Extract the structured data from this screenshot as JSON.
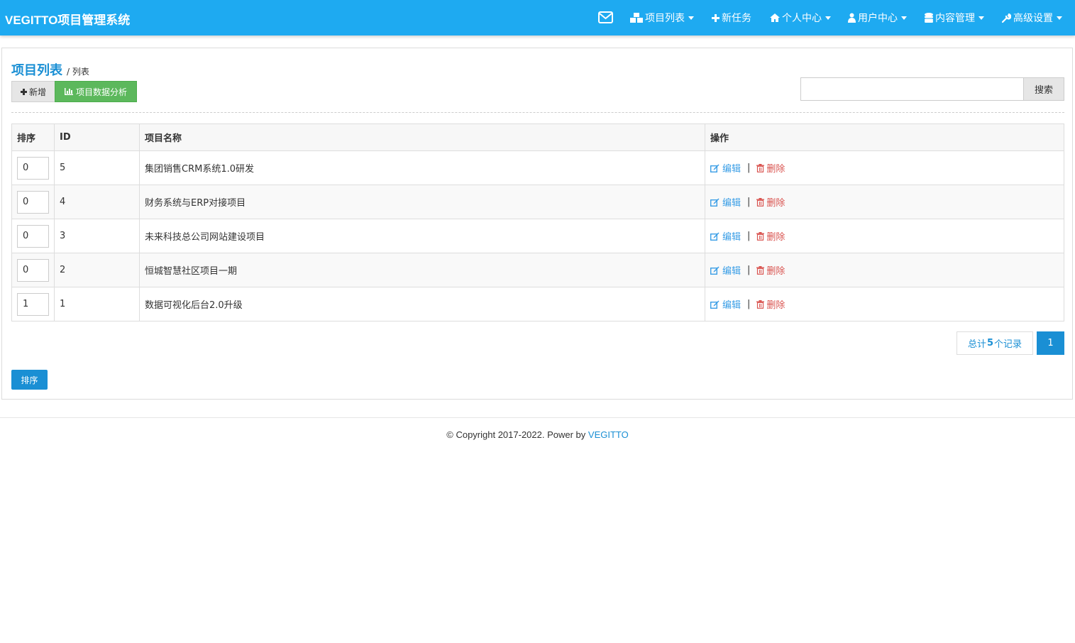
{
  "app": {
    "title": "VEGITTO项目管理系统"
  },
  "nav": {
    "items": [
      {
        "label": "项目列表",
        "icon": "cubes-icon",
        "dropdown": true
      },
      {
        "label": "新任务",
        "icon": "plus-icon",
        "dropdown": false
      },
      {
        "label": "个人中心",
        "icon": "home-icon",
        "dropdown": true
      },
      {
        "label": "用户中心",
        "icon": "user-icon",
        "dropdown": true
      },
      {
        "label": "内容管理",
        "icon": "database-icon",
        "dropdown": true
      },
      {
        "label": "高级设置",
        "icon": "wrench-icon",
        "dropdown": true
      }
    ]
  },
  "page": {
    "title": "项目列表",
    "subtitle": "/ 列表"
  },
  "toolbar": {
    "add_label": "新增",
    "analysis_label": "项目数据分析"
  },
  "search": {
    "placeholder": "",
    "button_label": "搜索"
  },
  "table": {
    "headers": [
      "排序",
      "ID",
      "项目名称",
      "操作"
    ],
    "rows": [
      {
        "sort": "0",
        "id": "5",
        "name": "集团销售CRM系统1.0研发"
      },
      {
        "sort": "0",
        "id": "4",
        "name": "财务系统与ERP对接项目"
      },
      {
        "sort": "0",
        "id": "3",
        "name": "未来科技总公司网站建设项目"
      },
      {
        "sort": "0",
        "id": "2",
        "name": "恒城智慧社区项目一期"
      },
      {
        "sort": "1",
        "id": "1",
        "name": "数据可视化后台2.0升级"
      }
    ],
    "edit_label": "编辑",
    "delete_label": "删除",
    "separator": "|"
  },
  "pagination": {
    "total_prefix": "总计",
    "total_count": "5",
    "total_suffix": "个记录",
    "current_page": "1"
  },
  "sort_button_label": "排序",
  "footer": {
    "copyright": "© Copyright 2017-2022. Power by ",
    "brand": "VEGITTO"
  },
  "colors": {
    "navbar": "#1eaaf1",
    "primary": "#1a8fd4",
    "success": "#5cb85c",
    "danger": "#d9534f"
  }
}
